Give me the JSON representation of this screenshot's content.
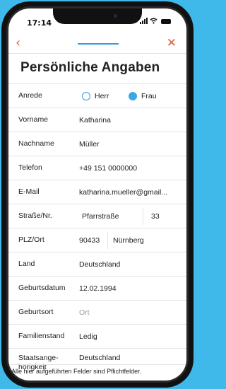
{
  "status": {
    "time": "17:14"
  },
  "nav": {
    "back": "‹",
    "close": "✕"
  },
  "title": "Persönliche Angaben",
  "fields": {
    "anrede": {
      "label": "Anrede",
      "options": [
        "Herr",
        "Frau"
      ],
      "selected": "Frau"
    },
    "vorname": {
      "label": "Vorname",
      "value": "Katharina"
    },
    "nachname": {
      "label": "Nachname",
      "value": "Müller"
    },
    "telefon": {
      "label": "Telefon",
      "value": "+49 151 0000000"
    },
    "email": {
      "label": "E-Mail",
      "value": "katharina.mueller@gmail..."
    },
    "strasse": {
      "label": "Straße/Nr.",
      "street": "Pfarrstraße",
      "number": "33"
    },
    "plzort": {
      "label": "PLZ/Ort",
      "plz": "90433",
      "ort": "Nürnberg"
    },
    "land": {
      "label": "Land",
      "value": "Deutschland"
    },
    "geburtsdatum": {
      "label": "Geburtsdatum",
      "value": "12.02.1994"
    },
    "geburtsort": {
      "label": "Geburtsort",
      "placeholder": "Ort"
    },
    "familienstand": {
      "label": "Familienstand",
      "value": "Ledig"
    },
    "staatsangehoerigkeit": {
      "label": "Staatsange-\nhörigkeit",
      "value": "Deutschland"
    }
  },
  "footer": "Alle hier aufgeführten Felder sind Pflichtfelder.",
  "colors": {
    "accent": "#e85b3a",
    "primary": "#3aa8e6",
    "background": "#3fb9e9"
  }
}
